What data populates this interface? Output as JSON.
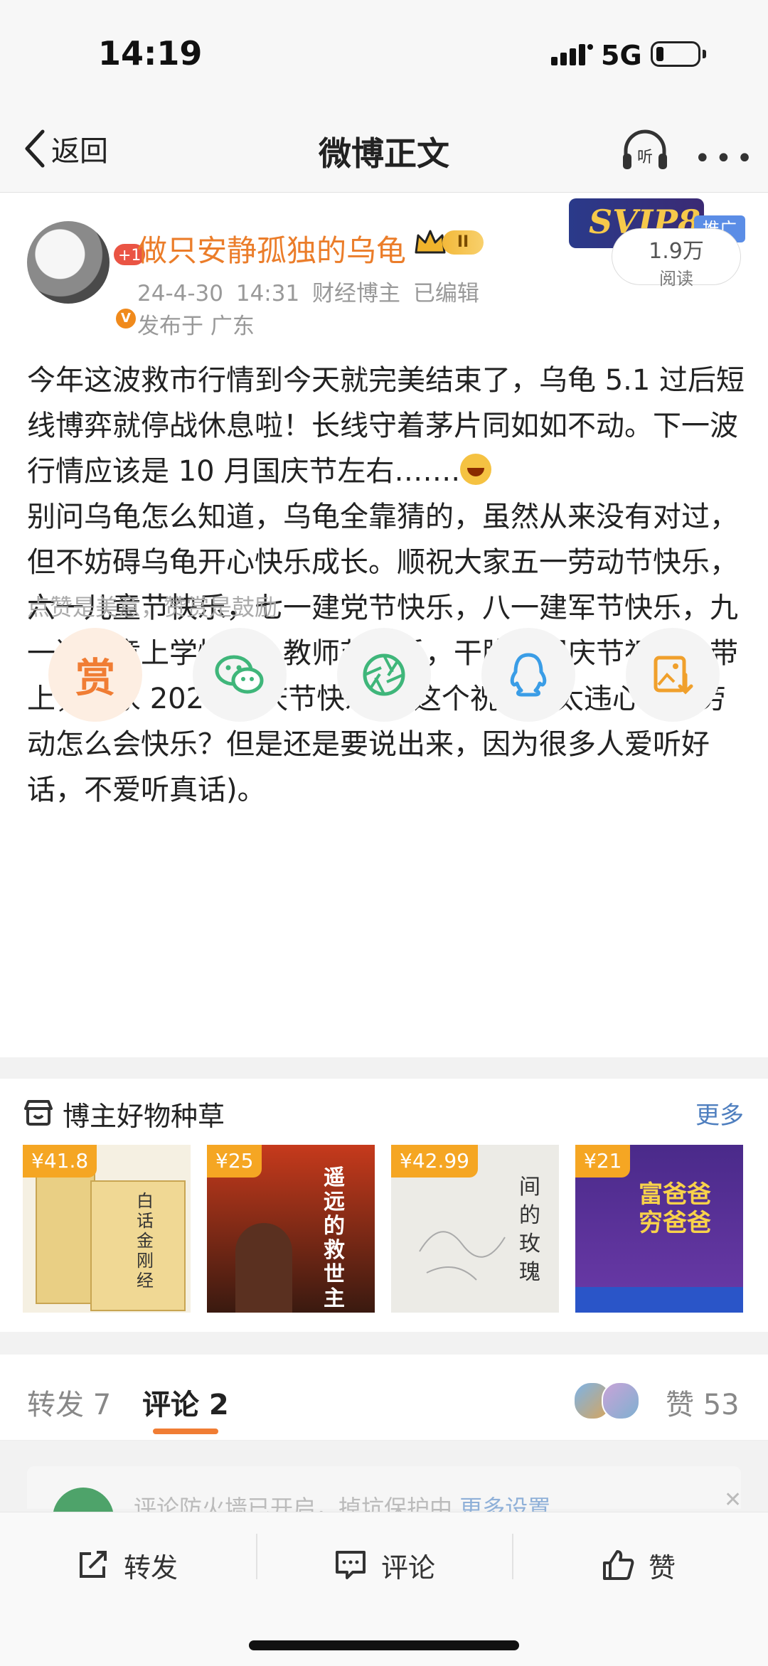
{
  "status_bar": {
    "time": "14:19",
    "network": "5G"
  },
  "nav": {
    "back_label": "返回",
    "title": "微博正文",
    "listen_label": "听"
  },
  "post": {
    "avatar_badge": "+1",
    "username": "做只安静孤独的乌龟",
    "level": "II",
    "meta": "24-4-30 14:31  财经博主  已编辑",
    "location": "发布于 广东",
    "svip": "SVIP8",
    "promo_tag": "推广",
    "read_count": "1.9万",
    "read_label": "阅读",
    "text_before_emoji": "今年这波救市行情到今天就完美结束了，乌龟 5.1 过后短线博弈就停战休息啦！长线守着茅片同如如不动。下一波行情应该是 10 月国庆节左右…….",
    "text_after_emoji": "别问乌龟怎么知道，乌龟全靠猜的，虽然从来没有对过，但不妨碍乌龟开心快乐成长。顺祝大家五一劳动节快乐，六一儿童节快乐，七一建党节快乐，八一建军节快乐，九一送神童上学快乐，教师节快乐，干脆把国庆节祝福也带上，大家 2024 国庆节快乐！(这个祝福也太违心了，劳动怎么会快乐？但是还是要说出来，因为很多人爱听好话，不爱听真话)。",
    "reward_tip": "点赞是美意，赞赏是鼓励",
    "reward_label": "赏"
  },
  "goods": {
    "title": "博主好物种草",
    "more": "更多",
    "items": [
      {
        "price": "¥41.8",
        "cover_text": "白话金刚经"
      },
      {
        "price": "¥25",
        "cover_text": "遥远的救世主"
      },
      {
        "price": "¥42.99",
        "cover_text": "间的玫瑰"
      },
      {
        "price": "¥21",
        "cover_text": "富爸爸穷爸爸"
      }
    ]
  },
  "tabs": {
    "forward": "转发 7",
    "comment": "评论 2",
    "like": "赞 53"
  },
  "notice": {
    "text": "评论防火墙已开启，掉坑保护中 ",
    "link": "更多设置"
  },
  "actions": {
    "forward": "转发",
    "comment": "评论",
    "like": "赞"
  },
  "colors": {
    "accent": "#f07d34",
    "username": "#eb7d2a",
    "link": "#4f7fbf"
  }
}
